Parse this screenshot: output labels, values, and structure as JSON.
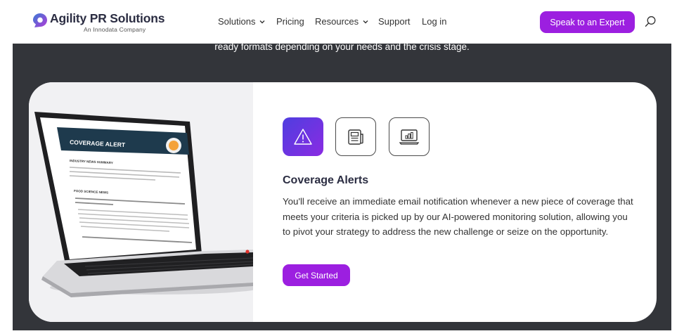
{
  "header": {
    "logo": {
      "name": "Agility PR Solutions",
      "tagline": "An Innodata Company",
      "colors": {
        "mark_gradient": [
          "#3a7bd5",
          "#b23ad6"
        ]
      }
    },
    "nav": [
      {
        "label": "Solutions",
        "has_dropdown": true
      },
      {
        "label": "Pricing",
        "has_dropdown": false
      },
      {
        "label": "Resources",
        "has_dropdown": true
      },
      {
        "label": "Support",
        "has_dropdown": false
      },
      {
        "label": "Log in",
        "has_dropdown": false
      }
    ],
    "cta_label": "Speak to an Expert",
    "search_icon": "search-icon"
  },
  "band": {
    "text": "ready formats depending on your needs and the crisis stage."
  },
  "feature": {
    "image": {
      "screen_title": "COVERAGE ALERT",
      "section_1": "INDUSTRY NEWS SUMMARY",
      "section_2": "FOOD SCIENCE NEWS",
      "headline": "Plant-Based Food Science and the Impact on Pizza: Next Generation Flavor, Texture and Nutrition",
      "subheadline": "Food science turns science fiction as 3D printer pizza makes pizza"
    },
    "icons": [
      {
        "name": "alert-triangle-icon",
        "active": true
      },
      {
        "name": "newspaper-icon",
        "active": false
      },
      {
        "name": "monitor-chart-icon",
        "active": false
      }
    ],
    "title": "Coverage Alerts",
    "description": "You'll receive an immediate email notification whenever a new piece of coverage that meets your criteria is picked up by our AI-powered monitoring solution, allowing you to pivot your strategy to address the new challenge or seize on the opportunity.",
    "button_label": "Get Started"
  },
  "colors": {
    "accent": "#9c1fe0",
    "band": "#33353a",
    "tile_gradient": [
      "#4f3ee0",
      "#8a2be2"
    ]
  }
}
